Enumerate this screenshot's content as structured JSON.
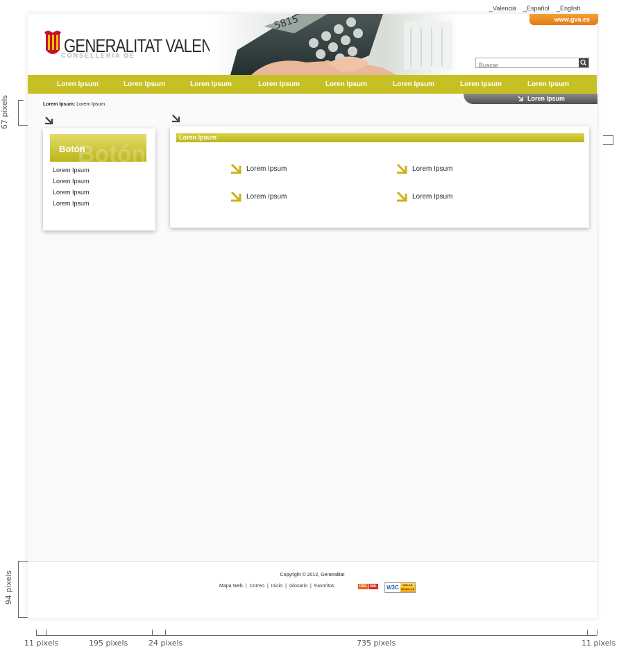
{
  "annotations": {
    "top_gap": "67 pixels",
    "footer_height": "94 pixels",
    "left_margin": "11 pixels",
    "sidebar_width": "195 pixels",
    "gutter": "24 pixels",
    "content_width": "735 pixels",
    "right_margin": "11 pixels"
  },
  "languages": [
    "_Valencià",
    "_Español",
    "_English"
  ],
  "gva_link": "www.gva.es",
  "logo": {
    "title": "GENERALITAT VALENCIANA",
    "subtitle": "CONSELLERIA DE"
  },
  "search": {
    "placeholder": "Buscar"
  },
  "nav": [
    "Loren Ipsum",
    "Loren Ipsum",
    "Loren Ipsum",
    "Loren Ipsum",
    "Loren Ipsum",
    "Loren Ipsum",
    "Loren Ipsum",
    "Loren Ipsum"
  ],
  "breadcrumb": {
    "bold": "Lorem Ipsum:",
    "rest": " Lorem Ipsum"
  },
  "quick_tab": "Loren Ipsum",
  "sidebar": {
    "title": "Botón",
    "ghost": "Botón",
    "items": [
      "Lorem Ipsum",
      "Lorem Ipsum",
      "Lorem Ipsum",
      "Lorem Ipsum"
    ]
  },
  "panel": {
    "title": "Loren Ipsum",
    "links": [
      "Lorem Ipsum",
      "Lorem Ipsum",
      "Lorem Ipsum",
      "Lorem Ipsum"
    ]
  },
  "footer": {
    "copyright": "Copyright © 2012, Generalitat",
    "links": [
      "Mapa Web",
      "Correo",
      "Inicio",
      "Glosario",
      "Favoritos"
    ],
    "rss": "RSS",
    "xml": "XML",
    "w3c": "W3C",
    "wai": "WAI-AA WCAG 1.0"
  },
  "colors": {
    "accent": "#c7c024",
    "orange": "#e8851e",
    "dark_tab": "#5a5a5a"
  }
}
